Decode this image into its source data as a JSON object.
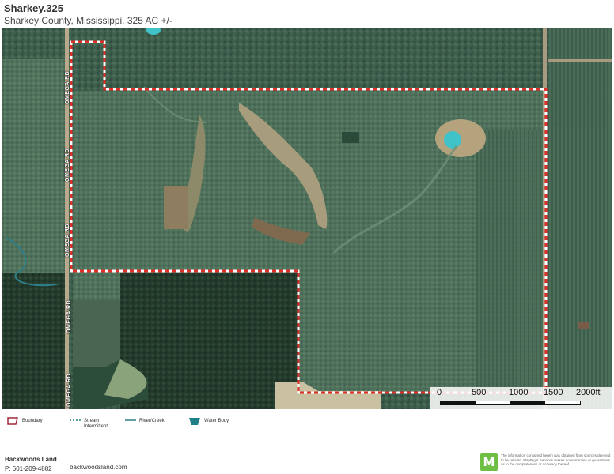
{
  "header": {
    "title": "Sharkey.325",
    "subtitle": "Sharkey County, Mississippi, 325 AC +/-"
  },
  "map": {
    "road_labels": [
      "OMEGA RD",
      "OMEGA RD",
      "OMEGA RD",
      "OMEGA RD",
      "OMEGA RD"
    ],
    "boundary_color": "#e0302a",
    "water_color": "#3fc2c8",
    "scale": {
      "labels": [
        "0",
        "500",
        "1000",
        "1500",
        "2000ft"
      ]
    }
  },
  "legend": {
    "items": [
      {
        "label": "Boundary",
        "icon": "boundary-icon",
        "color": "#a0283c"
      },
      {
        "label": "Stream, Intermittent",
        "icon": "stream-intermittent-icon",
        "color": "#2b7f86"
      },
      {
        "label": "River/Creek",
        "icon": "river-creek-icon",
        "color": "#2b7f86"
      },
      {
        "label": "Water Body",
        "icon": "water-body-icon",
        "color": "#1e7f86"
      }
    ]
  },
  "footer": {
    "company": "Backwoods Land",
    "phone": "P: 601-209-4882",
    "website": "backwoodsland.com",
    "logo_letter": "M",
    "disclaimer": "The information contained herein was obtained from sources deemed to be reliable. MapRight Services makes no warranties or guarantees as to the completeness or accuracy thereof."
  }
}
